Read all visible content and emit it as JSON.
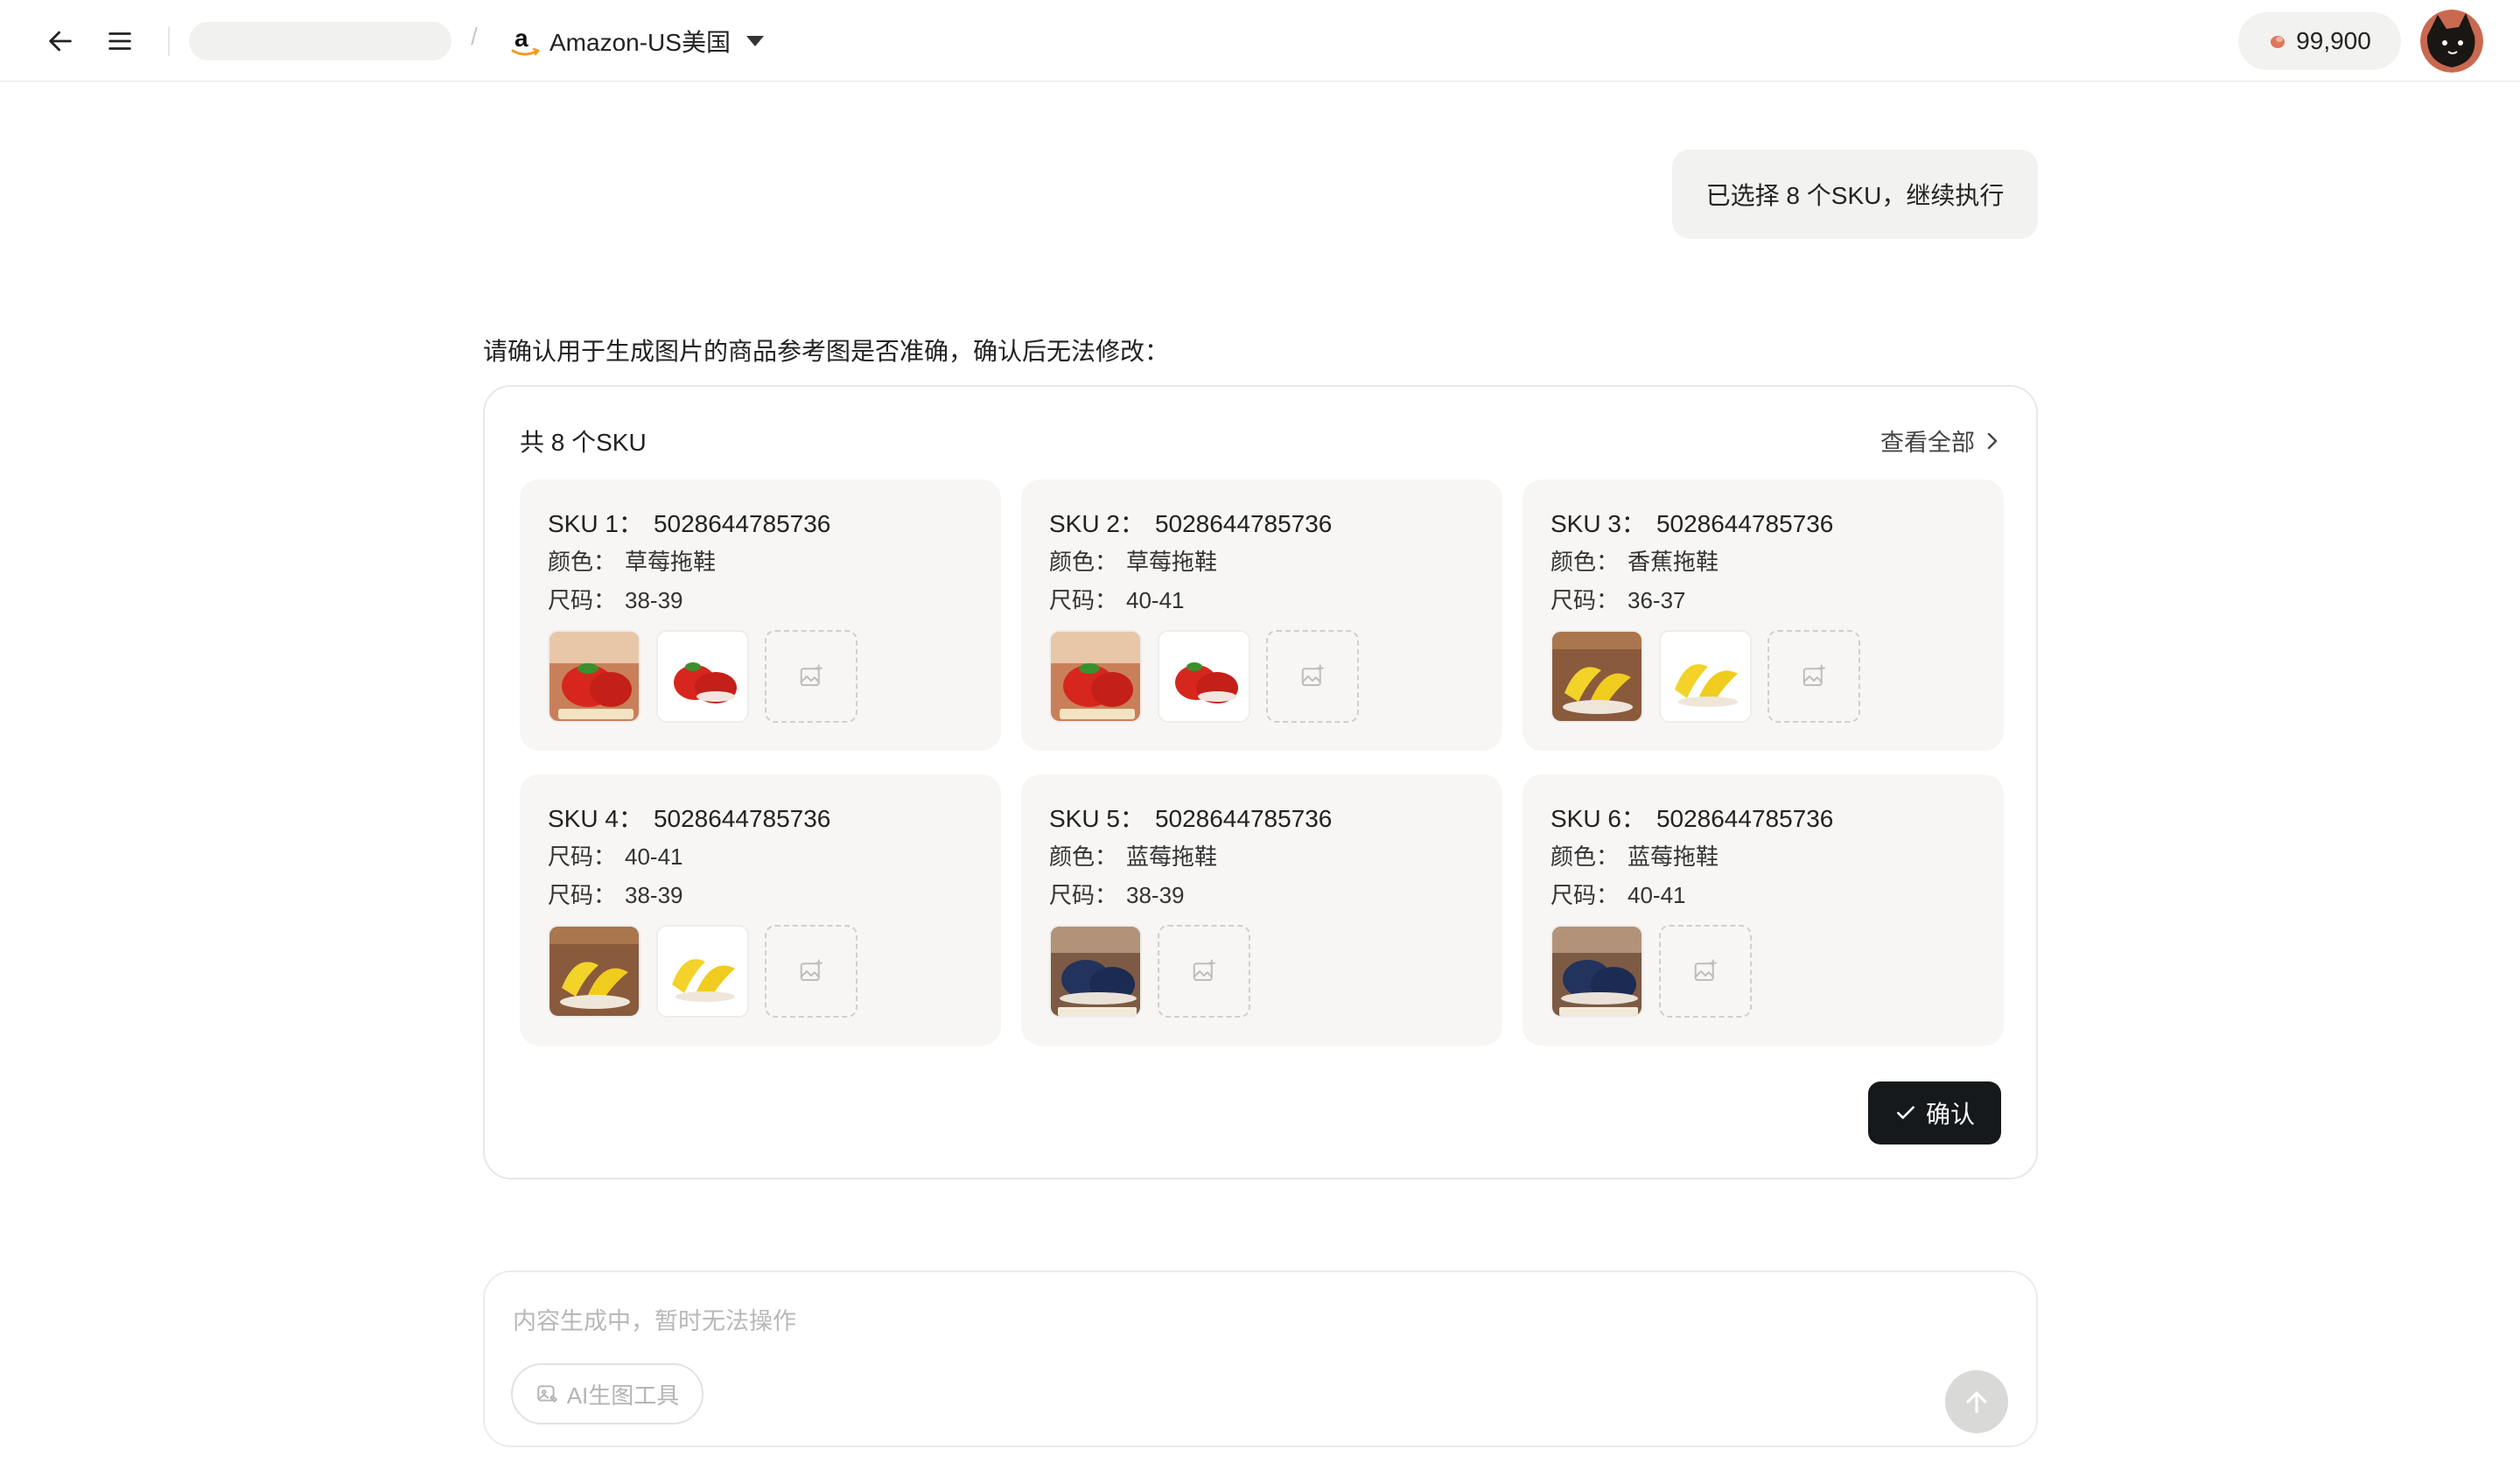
{
  "header": {
    "store_label": "Amazon-US美国",
    "breadcrumb_separator": "/",
    "credits": "99,900"
  },
  "chat": {
    "user_message": "已选择 8 个SKU，继续执行",
    "prompt": "请确认用于生成图片的商品参考图是否准确，确认后无法修改："
  },
  "card": {
    "count_label": "共 8 个SKU",
    "view_all_label": "查看全部",
    "confirm_label": "确认",
    "skus": [
      {
        "label": "SKU 1：",
        "id": "5028644785736",
        "attrs": [
          {
            "k": "颜色：",
            "v": "草莓拖鞋"
          },
          {
            "k": "尺码：",
            "v": "38-39"
          }
        ]
      },
      {
        "label": "SKU 2：",
        "id": "5028644785736",
        "attrs": [
          {
            "k": "颜色：",
            "v": "草莓拖鞋"
          },
          {
            "k": "尺码：",
            "v": "40-41"
          }
        ]
      },
      {
        "label": "SKU 3：",
        "id": "5028644785736",
        "attrs": [
          {
            "k": "颜色：",
            "v": "香蕉拖鞋"
          },
          {
            "k": "尺码：",
            "v": "36-37"
          }
        ]
      },
      {
        "label": "SKU 4：",
        "id": "5028644785736",
        "attrs": [
          {
            "k": "尺码：",
            "v": "40-41"
          },
          {
            "k": "尺码：",
            "v": "38-39"
          }
        ]
      },
      {
        "label": "SKU 5：",
        "id": "5028644785736",
        "attrs": [
          {
            "k": "颜色：",
            "v": "蓝莓拖鞋"
          },
          {
            "k": "尺码：",
            "v": "38-39"
          }
        ]
      },
      {
        "label": "SKU 6：",
        "id": "5028644785736",
        "attrs": [
          {
            "k": "颜色：",
            "v": "蓝莓拖鞋"
          },
          {
            "k": "尺码：",
            "v": "40-41"
          }
        ]
      }
    ]
  },
  "composer": {
    "placeholder": "内容生成中，暂时无法操作",
    "tool_label": "AI生图工具"
  },
  "colors": {
    "accent_dark": "#15191c",
    "panel_bg": "#f7f6f4",
    "border": "#e8e8e6"
  }
}
